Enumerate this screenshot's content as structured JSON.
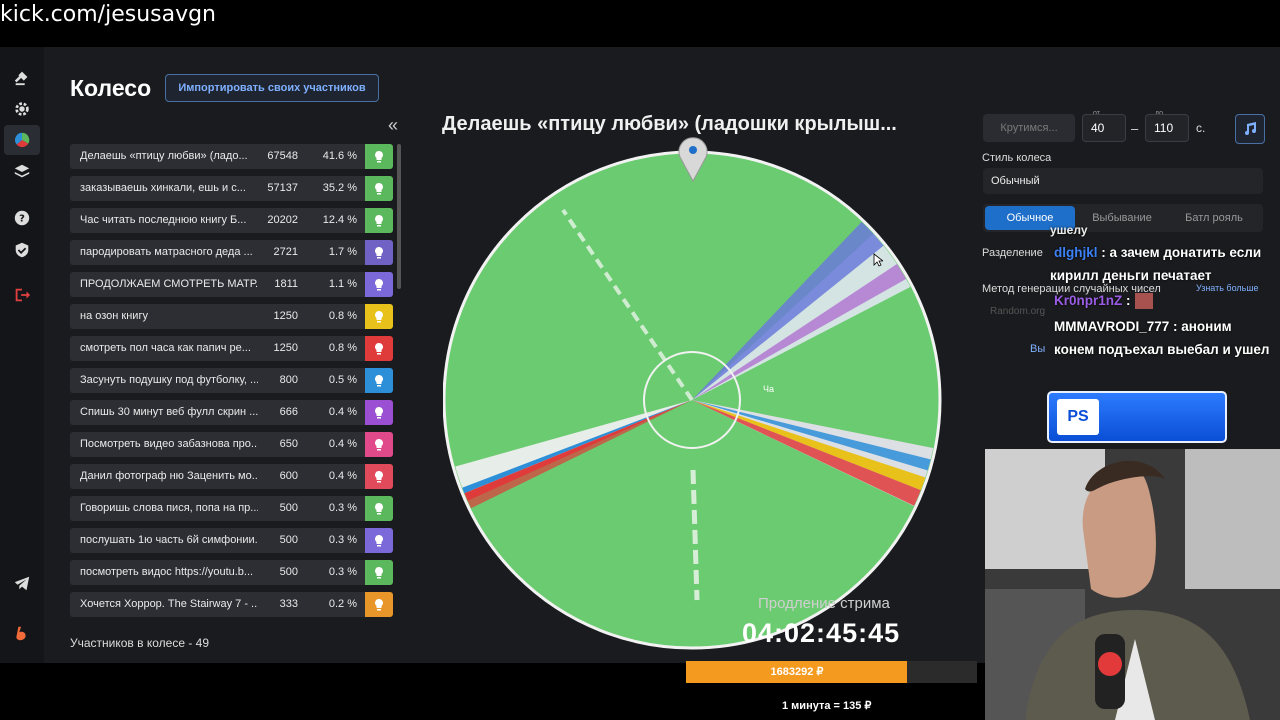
{
  "browser": {
    "url": "kick.com/jesusavgn"
  },
  "wheel_app": {
    "title": "Колесо",
    "import_button": "Импортировать своих участников",
    "collapse_glyph": "«",
    "participants_count": "Участников в колесе - 49",
    "wheel_title": "Делаешь «птицу любви» (ладошки крылыш...",
    "participants": [
      {
        "name": "Делаешь «птицу любви» (ладо...",
        "amount": "67548",
        "percent": "41.6 %",
        "color": "#5cb85c"
      },
      {
        "name": "заказываешь хинкали, ешь и с...",
        "amount": "57137",
        "percent": "35.2 %",
        "color": "#5cb85c"
      },
      {
        "name": "Час читать последнюю книгу Б...",
        "amount": "20202",
        "percent": "12.4 %",
        "color": "#5cb85c"
      },
      {
        "name": "пародировать матрасного деда ...",
        "amount": "2721",
        "percent": "1.7 %",
        "color": "#6f62c4"
      },
      {
        "name": "ПРОДОЛЖАЕМ СМОТРЕТЬ МАТР...",
        "amount": "1811",
        "percent": "1.1 %",
        "color": "#7b68d9"
      },
      {
        "name": "на озон книгу",
        "amount": "1250",
        "percent": "0.8 %",
        "color": "#e8c21a"
      },
      {
        "name": "смотреть пол часа как папич ре...",
        "amount": "1250",
        "percent": "0.8 %",
        "color": "#e03b3b"
      },
      {
        "name": "Засунуть подушку под футболку, ...",
        "amount": "800",
        "percent": "0.5 %",
        "color": "#2d8fd8"
      },
      {
        "name": "Спишь 30 минут веб фулл скрин ...",
        "amount": "666",
        "percent": "0.4 %",
        "color": "#9b4fd3"
      },
      {
        "name": "Посмотреть видео забазнова про...",
        "amount": "650",
        "percent": "0.4 %",
        "color": "#e04a8a"
      },
      {
        "name": "Данил фотограф ню Заценить мо...",
        "amount": "600",
        "percent": "0.4 %",
        "color": "#e04a5a"
      },
      {
        "name": "Говоришь слова пися, попа на пр...",
        "amount": "500",
        "percent": "0.3 %",
        "color": "#5cb85c"
      },
      {
        "name": "послушать 1ю часть 6й симфонии...",
        "amount": "500",
        "percent": "0.3 %",
        "color": "#7b68d9"
      },
      {
        "name": "посмотреть видос https://youtu.b...",
        "amount": "500",
        "percent": "0.3 %",
        "color": "#5cb85c"
      },
      {
        "name": "Хочется Хоррор. The Stairway 7 - ...",
        "amount": "333",
        "percent": "0.2 %",
        "color": "#e8952a"
      }
    ],
    "wheel_center_label": "Ча"
  },
  "settings": {
    "spin_button": "Крутимся...",
    "from_label": "от",
    "to_label": "до",
    "from_value": "40",
    "to_value": "110",
    "seconds": "с.",
    "dash": "–",
    "style_label": "Стиль колеса",
    "style_value": "Обычный",
    "modes": [
      "Обычное",
      "Выбывание",
      "Батл рояль"
    ],
    "split_label": "Разделение",
    "rng_label": "Метод генерации случайных чисел",
    "learn_more": "Узнать больше",
    "rng_value": "Random.org",
    "extra_link": "Вы"
  },
  "chat": {
    "lines": [
      {
        "text": "ушелу"
      },
      {
        "user": "dlghjkl",
        "text": " : а зачем донатить если"
      },
      {
        "text": "кирилл деньги печатает"
      },
      {
        "user": "Kr0npr1nZ",
        "text": " :"
      },
      {
        "text": "MMMAVRODI_777 : аноним"
      },
      {
        "text": "конем подъехал выебал и ушел"
      }
    ]
  },
  "overlay": {
    "ps_text": "PS",
    "extension_label": "Продление стрима",
    "timer": "04:02:45:45",
    "donation_total": "1683292 ₽",
    "donation_progress": 0.76,
    "rate": "1 минута = 135 ₽"
  }
}
